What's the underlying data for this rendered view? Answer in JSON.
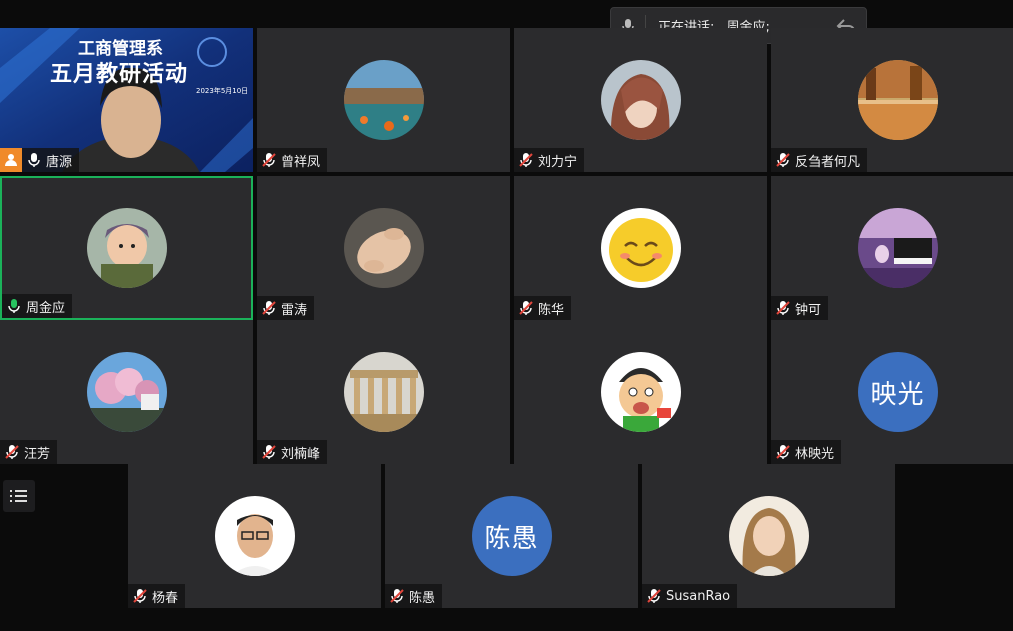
{
  "speaker_bar": {
    "label": "正在讲话:",
    "name": "周金应;"
  },
  "host_tile": {
    "banner_line1": "工商管理系",
    "banner_line2": "五月教研活动",
    "banner_date": "2023年5月10日",
    "name": "唐源"
  },
  "participants": [
    {
      "name": "曾祥凤",
      "avatar": "landscape-photo"
    },
    {
      "name": "刘力宁",
      "avatar": "woman-photo"
    },
    {
      "name": "反刍者何凡",
      "avatar": "autumn-lake-photo"
    },
    {
      "name": "周金应",
      "avatar": "child-photo",
      "speaking": true
    },
    {
      "name": "雷涛",
      "avatar": "hands-photo"
    },
    {
      "name": "陈华",
      "avatar": "smiley-face"
    },
    {
      "name": "钟可",
      "avatar": "piano-photo"
    },
    {
      "name": "汪芳",
      "avatar": "cherry-blossom-photo"
    },
    {
      "name": "刘楠峰",
      "avatar": "ruins-photo"
    },
    {
      "name": "",
      "avatar": "cartoon-character"
    },
    {
      "name": "林映光",
      "avatar_text": "映光"
    },
    {
      "name": "杨春",
      "avatar": "man-glasses-photo"
    },
    {
      "name": "陈愚",
      "avatar_text": "陈愚"
    },
    {
      "name": "SusanRao",
      "avatar": "woman-portrait-photo"
    }
  ],
  "colors": {
    "tile_bg": "#2b2b2d",
    "active_border": "#1bb25a",
    "host_badge": "#f08a2a",
    "letter_avatar": "#3b6fbf",
    "muted_mic": "#e0463c"
  }
}
